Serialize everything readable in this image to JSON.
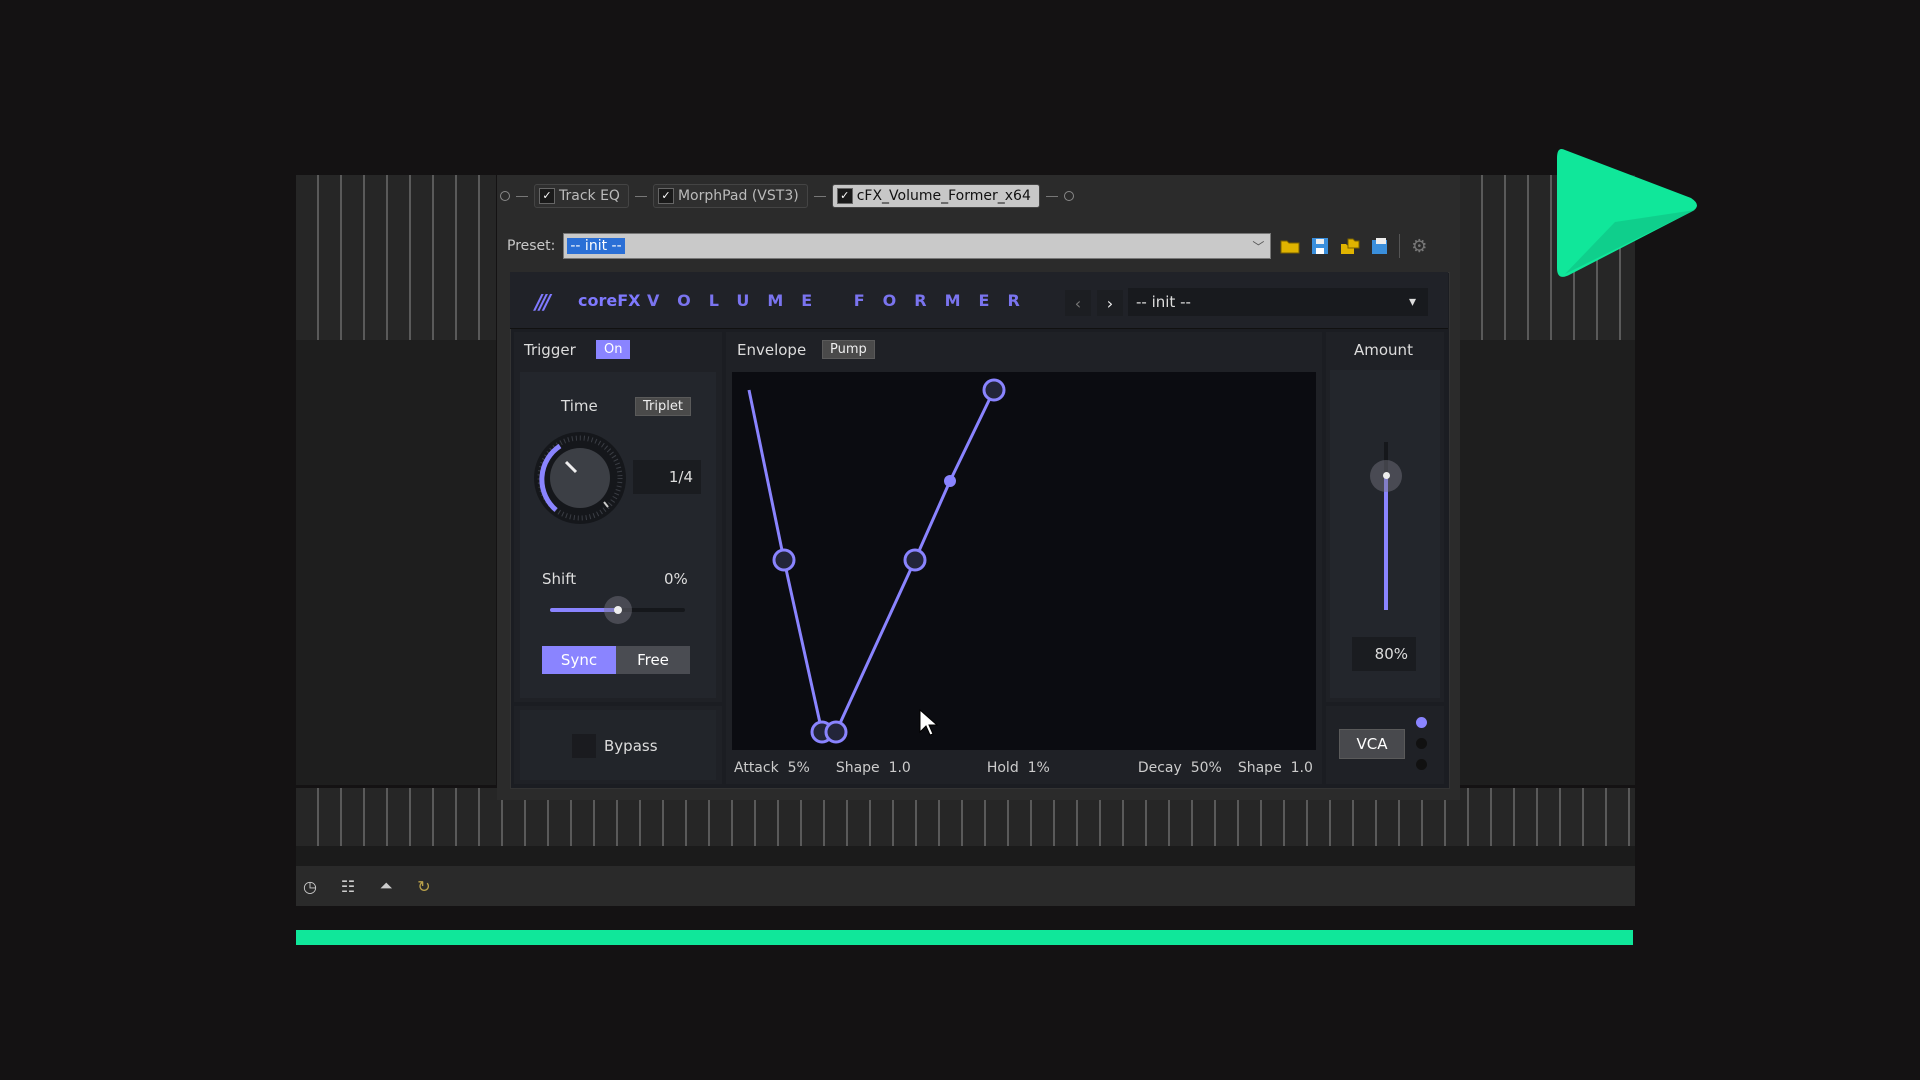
{
  "host": {
    "chain": [
      {
        "label": "Track EQ",
        "checked": true,
        "active": false
      },
      {
        "label": "MorphPad (VST3)",
        "checked": true,
        "active": false
      },
      {
        "label": "cFX_Volume_Former_x64",
        "checked": true,
        "active": true
      }
    ],
    "preset_label": "Preset:",
    "preset_value": "-- init --",
    "toolbar_icons": [
      "open-folder-icon",
      "save-icon",
      "export-icon",
      "save-as-icon",
      "settings-icon"
    ]
  },
  "plugin": {
    "brand": "coreFX",
    "title": "VOLUME FORMER",
    "preset_value": "-- init --",
    "trigger": {
      "label": "Trigger",
      "state": "On"
    },
    "time": {
      "label": "Time",
      "mode": "Triplet",
      "value": "1/4"
    },
    "shift": {
      "label": "Shift",
      "value": "0%",
      "fraction": 0.5
    },
    "sync_modes": [
      "Sync",
      "Free"
    ],
    "sync_active": "Sync",
    "bypass": "Bypass",
    "envelope": {
      "label": "Envelope",
      "mode": "Pump"
    },
    "params": {
      "attack_label": "Attack",
      "attack": "5%",
      "shape1_label": "Shape",
      "shape1": "1.0",
      "hold_label": "Hold",
      "hold": "1%",
      "decay_label": "Decay",
      "decay": "50%",
      "shape2_label": "Shape",
      "shape2": "1.0"
    },
    "amount": {
      "label": "Amount",
      "value": "80%",
      "fraction": 0.8
    },
    "vca": {
      "label": "VCA",
      "active_index": 0,
      "count": 3
    }
  },
  "colors": {
    "accent": "#8a84ff",
    "progress": "#10e79a",
    "logo": "#10e79a"
  },
  "daw_toolbar_icons": [
    "clock-icon",
    "mixer-icon",
    "metronome-icon",
    "loop-icon"
  ]
}
